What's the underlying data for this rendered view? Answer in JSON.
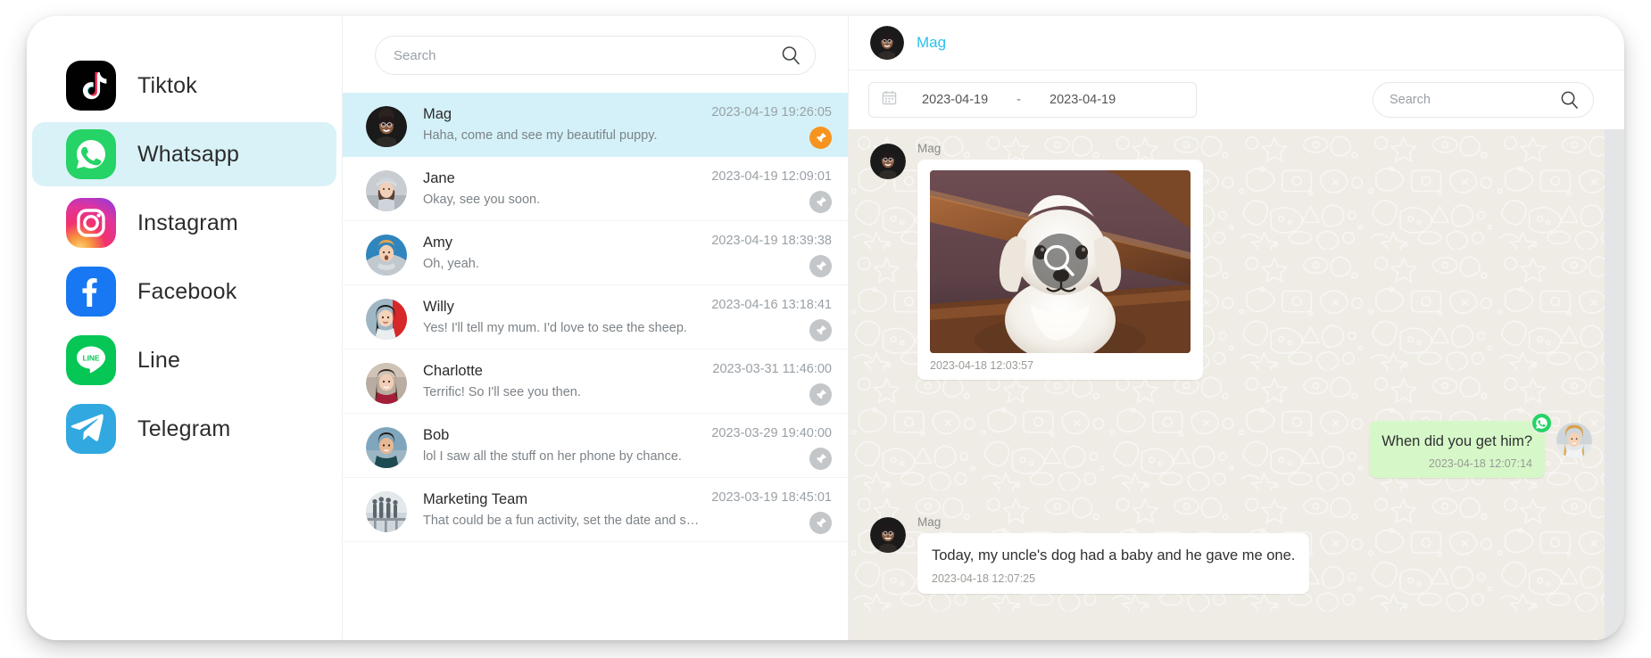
{
  "sidebar": {
    "items": [
      {
        "label": "Tiktok",
        "icon": "tiktok-icon",
        "active": false
      },
      {
        "label": "Whatsapp",
        "icon": "whatsapp-icon",
        "active": true
      },
      {
        "label": "Instagram",
        "icon": "instagram-icon",
        "active": false
      },
      {
        "label": "Facebook",
        "icon": "facebook-icon",
        "active": false
      },
      {
        "label": "Line",
        "icon": "line-icon",
        "active": false
      },
      {
        "label": "Telegram",
        "icon": "telegram-icon",
        "active": false
      }
    ],
    "active_highlight_color": "#D9F2F7"
  },
  "chat_list": {
    "search": {
      "placeholder": "Search",
      "value": ""
    },
    "rows": [
      {
        "name": "Mag",
        "preview": "Haha, come and see my beautiful puppy.",
        "time": "2023-04-19 19:26:05",
        "selected": true,
        "pinned": true
      },
      {
        "name": "Jane",
        "preview": "Okay, see you soon.",
        "time": "2023-04-19 12:09:01",
        "selected": false,
        "pinned": false
      },
      {
        "name": "Amy",
        "preview": "Oh, yeah.",
        "time": "2023-04-19 18:39:38",
        "selected": false,
        "pinned": false
      },
      {
        "name": "Willy",
        "preview": "Yes! I'll tell my mum. I'd love to see the sheep.",
        "time": "2023-04-16 13:18:41",
        "selected": false,
        "pinned": false
      },
      {
        "name": "Charlotte",
        "preview": "Terrific! So I'll see you then.",
        "time": "2023-03-31 11:46:00",
        "selected": false,
        "pinned": false
      },
      {
        "name": "Bob",
        "preview": "lol I saw all the stuff on her phone by chance.",
        "time": "2023-03-29 19:40:00",
        "selected": false,
        "pinned": false
      },
      {
        "name": "Marketing Team",
        "preview": "That could be a fun activity, set the date and send the i…",
        "time": "2023-03-19 18:45:01",
        "selected": false,
        "pinned": false
      }
    ],
    "selected_row_color": "#D4F1F9",
    "pin_active_color": "#F7931E",
    "pin_inactive_color": "#C3C7CA"
  },
  "conversation": {
    "header": {
      "title": "Mag",
      "title_color": "#29C2EC",
      "avatar": "avatar-mag"
    },
    "filter": {
      "calendar_icon": "calendar-icon",
      "date_from": "2023-04-19",
      "separator": "-",
      "date_to": "2023-04-19",
      "search": {
        "placeholder": "Search",
        "value": ""
      }
    },
    "messages": [
      {
        "type": "image",
        "direction": "in",
        "sender": "Mag",
        "time": "2023-04-18 12:03:57",
        "overlay_icon": "magnifier-icon",
        "image_alt": "white puppy sitting on wooden logs"
      },
      {
        "type": "text",
        "direction": "out",
        "sender": "",
        "text": "When did you get him?",
        "time": "2023-04-18 12:07:14",
        "badge_icon": "whatsapp-icon"
      },
      {
        "type": "text",
        "direction": "in",
        "sender": "Mag",
        "text": "Today, my uncle's dog had a baby and he gave me one.",
        "time": "2023-04-18 12:07:25"
      }
    ],
    "background_color": "#EFEBE5",
    "outgoing_bubble_color": "#D6F8C8",
    "incoming_bubble_color": "#FFFFFF"
  }
}
